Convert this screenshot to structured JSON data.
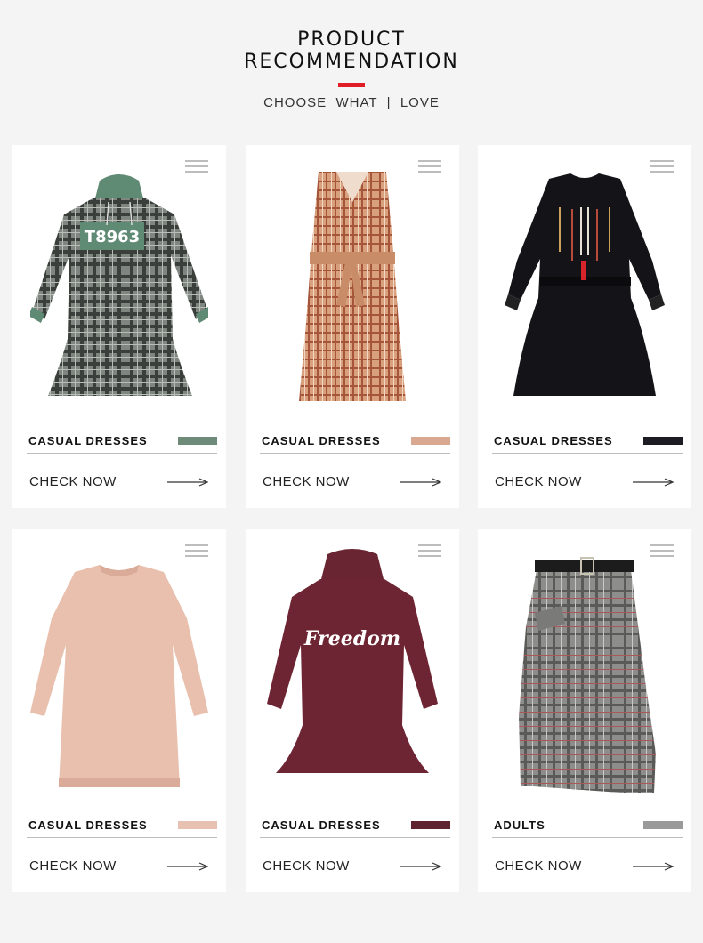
{
  "header": {
    "title_line1": "PRODUCT",
    "title_line2": "RECOMMENDATION",
    "subtitle": "CHOOSE  WHAT  |  LOVE",
    "accent_color": "#e01c24"
  },
  "products": [
    {
      "category": "CASUAL DRESSES",
      "cta": "CHECK NOW",
      "swatch_color": "#6e8a78",
      "image": "green-plaid-hoodie-dress",
      "print_text": "T8963"
    },
    {
      "category": "CASUAL DRESSES",
      "cta": "CHECK NOW",
      "swatch_color": "#d8a990",
      "image": "camel-check-belted-dress"
    },
    {
      "category": "CASUAL DRESSES",
      "cta": "CHECK NOW",
      "swatch_color": "#1c1c22",
      "image": "black-embroidered-dress"
    },
    {
      "category": "CASUAL DRESSES",
      "cta": "CHECK NOW",
      "swatch_color": "#e7c2b2",
      "image": "pink-knit-sweater-dress"
    },
    {
      "category": "CASUAL DRESSES",
      "cta": "CHECK NOW",
      "swatch_color": "#5e2430",
      "image": "burgundy-hoodie-dress",
      "print_text": "Freedom"
    },
    {
      "category": "ADULTS",
      "cta": "CHECK NOW",
      "swatch_color": "#9a9a9a",
      "image": "grey-plaid-wrap-skirt"
    }
  ]
}
